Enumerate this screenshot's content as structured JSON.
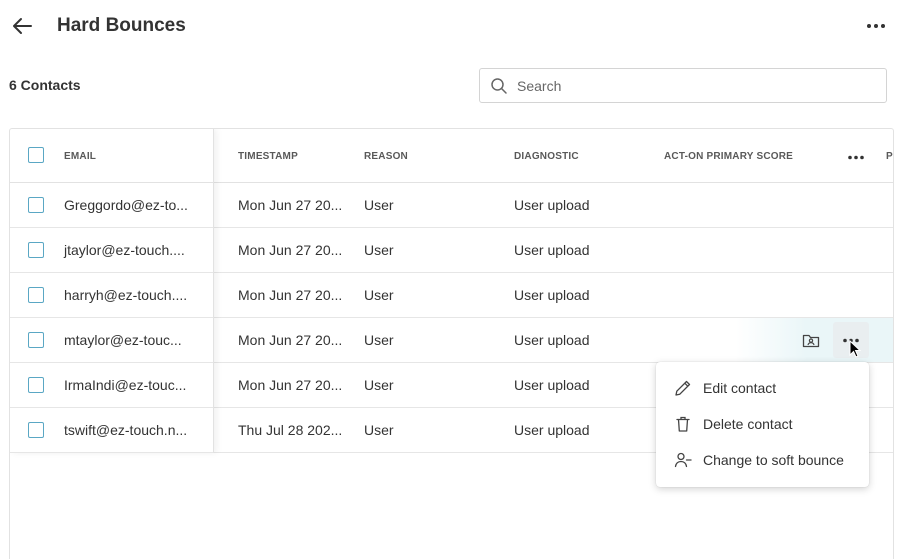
{
  "header": {
    "title": "Hard Bounces"
  },
  "toolbar": {
    "count_label": "6 Contacts",
    "search_placeholder": "Search"
  },
  "table": {
    "columns": [
      "EMAIL",
      "TIMESTAMP",
      "REASON",
      "DIAGNOSTIC",
      "ACT-ON PRIMARY SCORE",
      "P"
    ],
    "rows": [
      {
        "email": "Greggordo@ez-to...",
        "timestamp": "Mon Jun 27 20...",
        "reason": "User",
        "diagnostic": "User upload"
      },
      {
        "email": "jtaylor@ez-touch....",
        "timestamp": "Mon Jun 27 20...",
        "reason": "User",
        "diagnostic": "User upload"
      },
      {
        "email": "harryh@ez-touch....",
        "timestamp": "Mon Jun 27 20...",
        "reason": "User",
        "diagnostic": "User upload"
      },
      {
        "email": "mtaylor@ez-touc...",
        "timestamp": "Mon Jun 27 20...",
        "reason": "User",
        "diagnostic": "User upload"
      },
      {
        "email": "IrmaIndi@ez-touc...",
        "timestamp": "Mon Jun 27 20...",
        "reason": "User",
        "diagnostic": "User upload"
      },
      {
        "email": "tswift@ez-touch.n...",
        "timestamp": "Thu Jul 28 202...",
        "reason": "User",
        "diagnostic": "User upload"
      }
    ]
  },
  "row_menu": {
    "items": [
      {
        "label": "Edit contact",
        "icon": "pencil-icon"
      },
      {
        "label": "Delete contact",
        "icon": "trash-icon"
      },
      {
        "label": "Change to soft bounce",
        "icon": "user-minus-icon"
      }
    ]
  },
  "colors": {
    "accent": "#5aa7c4",
    "text": "#333333",
    "border": "#e2e2e2",
    "row_hover": "#eaf6f8"
  }
}
